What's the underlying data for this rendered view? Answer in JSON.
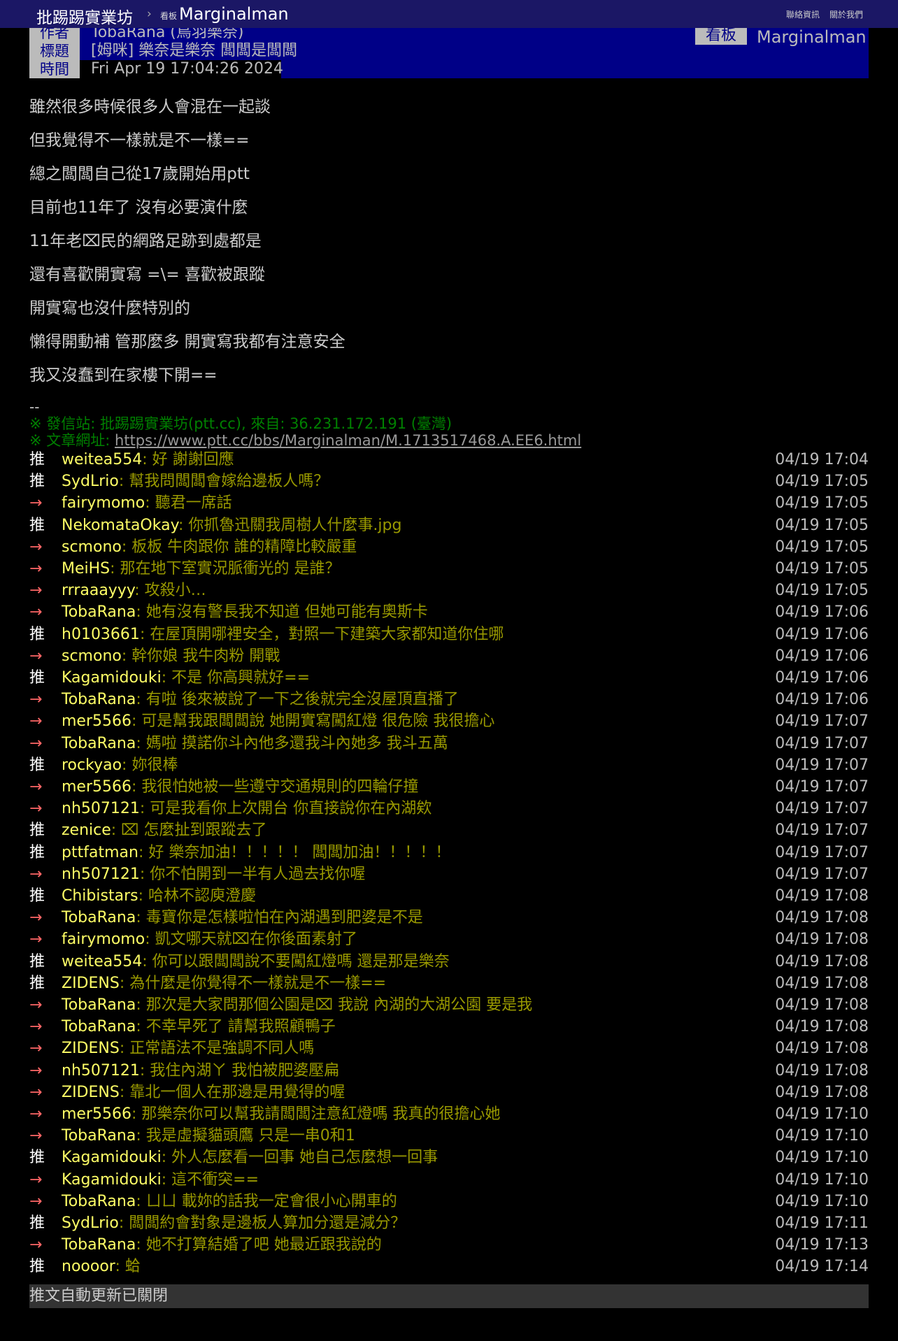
{
  "topbar": {
    "site": "批踢踢實業坊",
    "sep": "›",
    "board_tag": "看板",
    "board_name": "Marginalman",
    "links": [
      "聯絡資訊",
      "關於我們"
    ]
  },
  "meta": {
    "author_tag": "作者",
    "author": "TobaRana (鳥羽樂奈)",
    "title_tag": "標題",
    "title": "[姆咪] 樂奈是樂奈 闆闆是闆闆",
    "time_tag": "時間",
    "time": "Fri Apr 19 17:04:26 2024",
    "board_tag": "看板",
    "board": "Marginalman"
  },
  "body": [
    "雖然很多時候很多人會混在一起談",
    "但我覺得不一樣就是不一樣==",
    "總之闆闆自己從17歲開始用ptt",
    "目前也11年了 沒有必要演什麼",
    "11年老⌧民的網路足跡到處都是",
    "還有喜歡開實寫 =\\= 喜歡被跟蹤",
    "開實寫也沒什麼特別的",
    "懶得開動補 管那麼多 開實寫我都有注意安全",
    "我又沒蠢到在家樓下開=="
  ],
  "dash": "--",
  "signature": {
    "origin": "※ 發信站: 批踢踢實業坊(ptt.cc), 來自: 36.231.172.191 (臺灣)",
    "url_label": "※ 文章網址: ",
    "url": "https://www.ptt.cc/bbs/Marginalman/M.1713517468.A.EE6.html"
  },
  "pushes": [
    {
      "tag": "推",
      "user": "weitea554",
      "content": ": 好 謝謝回應",
      "time": "04/19 17:04"
    },
    {
      "tag": "推",
      "user": "SydLrio",
      "content": ": 幫我問闆闆會嫁給邊板人嗎？",
      "time": "04/19 17:05"
    },
    {
      "tag": "→",
      "user": "fairymomo",
      "content": ": 聽君一席話",
      "time": "04/19 17:05"
    },
    {
      "tag": "推",
      "user": "NekomataOkay",
      "content": ": 你抓魯迅關我周樹人什麼事.jpg",
      "time": "04/19 17:05"
    },
    {
      "tag": "→",
      "user": "scmono",
      "content": ": 板板 牛肉跟你 誰的精障比較嚴重",
      "time": "04/19 17:05"
    },
    {
      "tag": "→",
      "user": "MeiHS",
      "content": ": 那在地下室實況脈衝光的 是誰？",
      "time": "04/19 17:05"
    },
    {
      "tag": "→",
      "user": "rrraaayyy",
      "content": ": 攻殺小…",
      "time": "04/19 17:05"
    },
    {
      "tag": "→",
      "user": "TobaRana",
      "content": ": 她有沒有警長我不知道 但她可能有奧斯卡",
      "time": "04/19 17:06"
    },
    {
      "tag": "推",
      "user": "h0103661",
      "content": ": 在屋頂開哪裡安全，對照一下建築大家都知道你住哪",
      "time": "04/19 17:06"
    },
    {
      "tag": "→",
      "user": "scmono",
      "content": ": 幹你娘 我牛肉粉 開戰",
      "time": "04/19 17:06"
    },
    {
      "tag": "推",
      "user": "Kagamidouki",
      "content": ": 不是 你高興就好==",
      "time": "04/19 17:06"
    },
    {
      "tag": "→",
      "user": "TobaRana",
      "content": ": 有啦 後來被說了一下之後就完全沒屋頂直播了",
      "time": "04/19 17:06"
    },
    {
      "tag": "→",
      "user": "mer5566",
      "content": ": 可是幫我跟闆闆說 她開實寫闖紅燈 很危險 我很擔心",
      "time": "04/19 17:07"
    },
    {
      "tag": "→",
      "user": "TobaRana",
      "content": ": 媽啦 摸諾你斗內他多還我斗內她多 我斗五萬",
      "time": "04/19 17:07"
    },
    {
      "tag": "推",
      "user": "rockyao",
      "content": ": 妳很棒",
      "time": "04/19 17:07"
    },
    {
      "tag": "→",
      "user": "mer5566",
      "content": ": 我很怕她被一些遵守交通規則的四輪仔撞",
      "time": "04/19 17:07"
    },
    {
      "tag": "→",
      "user": "nh507121",
      "content": ": 可是我看你上次開台 你直接說你在內湖欸",
      "time": "04/19 17:07"
    },
    {
      "tag": "推",
      "user": "zenice",
      "content": ": ⌧ 怎麼扯到跟蹤去了",
      "time": "04/19 17:07"
    },
    {
      "tag": "推",
      "user": "pttfatman",
      "content": ": 好 樂奈加油！！！！！ 闆闆加油！！！！！",
      "time": "04/19 17:07"
    },
    {
      "tag": "→",
      "user": "nh507121",
      "content": ": 你不怕開到一半有人過去找你喔",
      "time": "04/19 17:07"
    },
    {
      "tag": "推",
      "user": "Chibistars",
      "content": ": 哈林不認庾澄慶",
      "time": "04/19 17:08"
    },
    {
      "tag": "→",
      "user": "TobaRana",
      "content": ": 毒寶你是怎樣啦怕在內湖遇到肥婆是不是",
      "time": "04/19 17:08"
    },
    {
      "tag": "→",
      "user": "fairymomo",
      "content": ": 凱文哪天就⌧在你後面素射了",
      "time": "04/19 17:08"
    },
    {
      "tag": "推",
      "user": "weitea554",
      "content": ": 你可以跟闆闆說不要闖紅燈嗎 還是那是樂奈",
      "time": "04/19 17:08"
    },
    {
      "tag": "推",
      "user": "ZIDENS",
      "content": ": 為什麼是你覺得不一樣就是不一樣==",
      "time": "04/19 17:08"
    },
    {
      "tag": "→",
      "user": "TobaRana",
      "content": ": 那次是大家問那個公園是⌧ 我說 內湖的大湖公園 要是我",
      "time": "04/19 17:08"
    },
    {
      "tag": "→",
      "user": "TobaRana",
      "content": ": 不幸早死了 請幫我照顧鴨子",
      "time": "04/19 17:08"
    },
    {
      "tag": "→",
      "user": "ZIDENS",
      "content": ": 正常語法不是強調不同人嗎",
      "time": "04/19 17:08"
    },
    {
      "tag": "→",
      "user": "nh507121",
      "content": ": 我住內湖ㄚ 我怕被肥婆壓扁",
      "time": "04/19 17:08"
    },
    {
      "tag": "→",
      "user": "ZIDENS",
      "content": ": 靠北一個人在那邊是用覺得的喔",
      "time": "04/19 17:08"
    },
    {
      "tag": "→",
      "user": "mer5566",
      "content": ": 那樂奈你可以幫我請闆闆注意紅燈嗎 我真的很擔心她",
      "time": "04/19 17:10"
    },
    {
      "tag": "→",
      "user": "TobaRana",
      "content": ": 我是虛擬貓頭鷹 只是一串0和1",
      "time": "04/19 17:10"
    },
    {
      "tag": "推",
      "user": "Kagamidouki",
      "content": ": 外人怎麼看一回事 她自己怎麼想一回事",
      "time": "04/19 17:10"
    },
    {
      "tag": "→",
      "user": "Kagamidouki",
      "content": ": 這不衝突==",
      "time": "04/19 17:10"
    },
    {
      "tag": "→",
      "user": "TobaRana",
      "content": ": ㄩㄩ 載妳的話我一定會很小心開車的",
      "time": "04/19 17:10"
    },
    {
      "tag": "推",
      "user": "SydLrio",
      "content": ": 闆闆約會對象是邊板人算加分還是減分？",
      "time": "04/19 17:11"
    },
    {
      "tag": "→",
      "user": "TobaRana",
      "content": ": 她不打算結婚了吧 她最近跟我說的",
      "time": "04/19 17:13"
    },
    {
      "tag": "推",
      "user": "noooor",
      "content": ": 蛤",
      "time": "04/19 17:14"
    }
  ],
  "footer": "推文自動更新已關閉",
  "colors": {
    "topbar": "#1b1765",
    "meta_bg": "#000087",
    "user": "#ffff66",
    "content": "#999900",
    "arrow": "#ff6666",
    "signature": "#008000"
  }
}
